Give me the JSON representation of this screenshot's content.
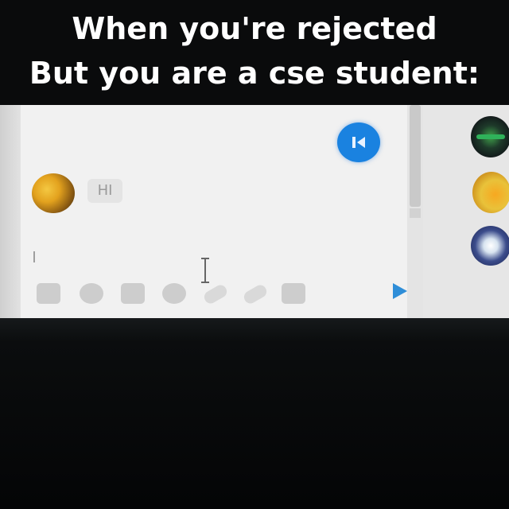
{
  "caption": {
    "line1": "When you're rejected",
    "line2": "But you are a cse student:"
  },
  "chat": {
    "messages": [
      {
        "text": "HI"
      }
    ],
    "toolbar_icons": [
      "image-icon",
      "sticker-icon",
      "gif-icon",
      "emoji-icon",
      "attach-icon",
      "link-icon",
      "camera-icon"
    ],
    "send_icon": "send-icon",
    "header_button_icon": "skip-back-icon"
  },
  "contacts": [
    "contact-avatar-1",
    "contact-avatar-2",
    "contact-avatar-3"
  ],
  "colors": {
    "accent_blue": "#1a82e0",
    "send_blue": "#2f8ed8",
    "caption_text": "#ffffff",
    "caption_bg": "#0a0b0c"
  }
}
